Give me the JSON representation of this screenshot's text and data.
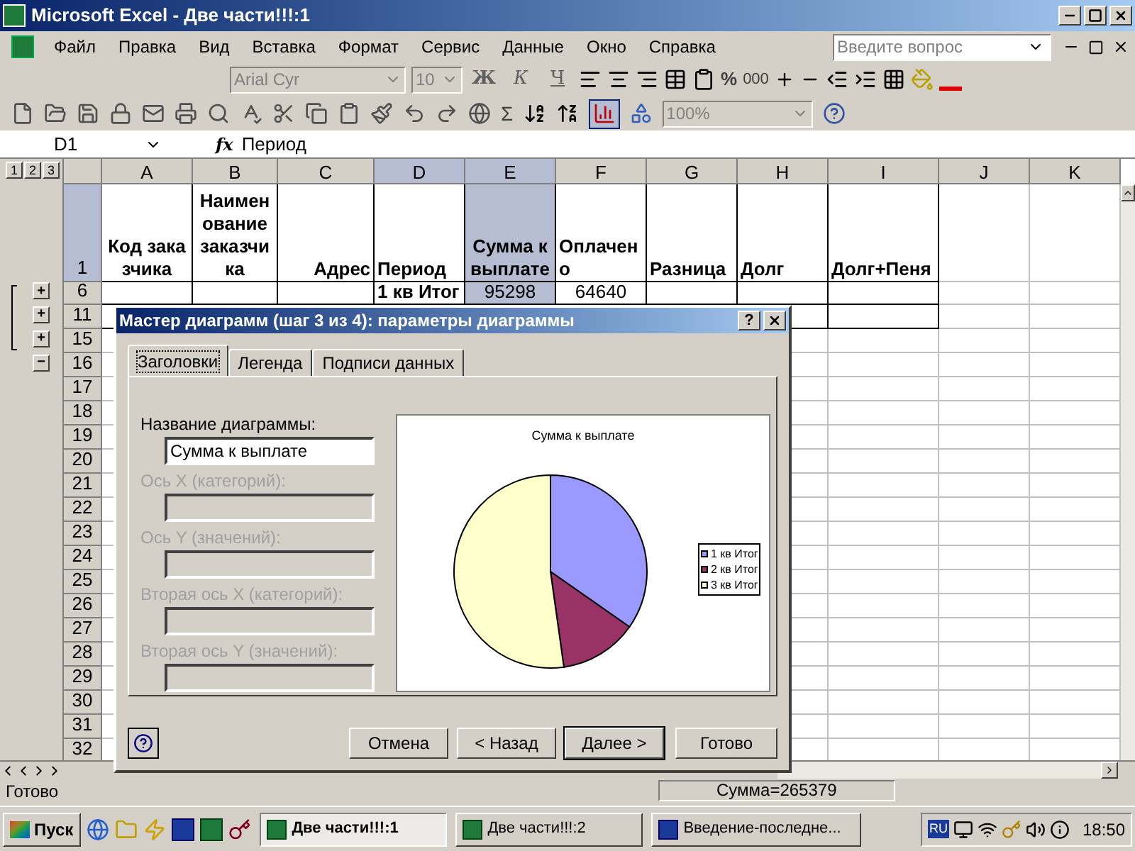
{
  "window": {
    "title": "Microsoft Excel - Две части!!!:1"
  },
  "menu": [
    "Файл",
    "Правка",
    "Вид",
    "Вставка",
    "Формат",
    "Сервис",
    "Данные",
    "Окно",
    "Справка"
  ],
  "help_search": {
    "placeholder": "Введите вопрос"
  },
  "formatting_toolbar": {
    "font": "Arial Cyr",
    "size": "10",
    "style_buttons": [
      "Ж",
      "К",
      "Ч"
    ],
    "percent": "%",
    "thousands": "000"
  },
  "standard_toolbar": {
    "sum": "Σ",
    "zoom": "100%",
    "chart_wizard_pressed": true
  },
  "formula_bar": {
    "cell": "D1",
    "fx": "fx",
    "value": "Период"
  },
  "outline_levels": [
    "1",
    "2",
    "3"
  ],
  "sheet": {
    "columns": [
      {
        "label": "A",
        "selected": false
      },
      {
        "label": "B",
        "selected": false
      },
      {
        "label": "C",
        "selected": false
      },
      {
        "label": "D",
        "selected": true
      },
      {
        "label": "E",
        "selected": true
      },
      {
        "label": "F",
        "selected": false
      },
      {
        "label": "G",
        "selected": false
      },
      {
        "label": "H",
        "selected": false
      },
      {
        "label": "I",
        "selected": false
      },
      {
        "label": "J",
        "selected": false
      },
      {
        "label": "K",
        "selected": false
      }
    ],
    "rows": [
      {
        "label": "1",
        "selected": true,
        "kind": "header",
        "cells": [
          {
            "text": "Код заказчика",
            "kind": "label",
            "selected": false
          },
          {
            "text": "Наименование заказчика",
            "kind": "label",
            "selected": false
          },
          {
            "text": "Адрес",
            "kind": "label",
            "selected": false
          },
          {
            "text": "Период",
            "kind": "label",
            "selected": false
          },
          {
            "text": "Сумма к выплате",
            "kind": "label",
            "selected": true
          },
          {
            "text": "Оплачено",
            "kind": "label",
            "selected": false
          },
          {
            "text": "Разница",
            "kind": "label",
            "selected": false
          },
          {
            "text": "Долг",
            "kind": "label",
            "selected": false
          },
          {
            "text": "Долг+Пеня",
            "kind": "label",
            "selected": false
          }
        ]
      },
      {
        "label": "6",
        "selected": false,
        "kind": "data",
        "outline": "+",
        "cells": [
          null,
          null,
          null,
          {
            "text": "1 кв Итог",
            "kind": "label",
            "selected": false
          },
          {
            "text": "95298",
            "kind": "number",
            "selected": true
          },
          {
            "text": "64640",
            "kind": "number",
            "selected": false
          }
        ]
      },
      {
        "label": "11",
        "selected": false,
        "kind": "data",
        "outline": "+"
      },
      {
        "label": "15",
        "selected": false,
        "kind": "empty",
        "outline": "+"
      },
      {
        "label": "16",
        "selected": false,
        "kind": "empty",
        "outline": "−"
      },
      {
        "label": "17",
        "selected": false,
        "kind": "empty"
      },
      {
        "label": "18",
        "selected": false,
        "kind": "empty"
      },
      {
        "label": "19",
        "selected": false,
        "kind": "empty"
      },
      {
        "label": "20",
        "selected": false,
        "kind": "empty"
      },
      {
        "label": "21",
        "selected": false,
        "kind": "empty"
      },
      {
        "label": "22",
        "selected": false,
        "kind": "empty"
      },
      {
        "label": "23",
        "selected": false,
        "kind": "empty"
      },
      {
        "label": "24",
        "selected": false,
        "kind": "empty"
      },
      {
        "label": "25",
        "selected": false,
        "kind": "empty"
      },
      {
        "label": "26",
        "selected": false,
        "kind": "empty"
      },
      {
        "label": "27",
        "selected": false,
        "kind": "empty"
      },
      {
        "label": "28",
        "selected": false,
        "kind": "empty"
      },
      {
        "label": "29",
        "selected": false,
        "kind": "empty"
      },
      {
        "label": "30",
        "selected": false,
        "kind": "empty"
      },
      {
        "label": "31",
        "selected": false,
        "kind": "empty"
      },
      {
        "label": "32",
        "selected": false,
        "kind": "empty"
      }
    ]
  },
  "dialog": {
    "title": "Мастер диаграмм (шаг 3 из 4): параметры диаграммы",
    "help": "?",
    "tabs": [
      {
        "label": "Заголовки",
        "selected": true
      },
      {
        "label": "Легенда",
        "selected": false
      },
      {
        "label": "Подписи данных",
        "selected": false
      }
    ],
    "fields": [
      {
        "label": "Название диаграммы:",
        "value": "Сумма к выплате",
        "disabled": false
      },
      {
        "label": "Ось X (категорий):",
        "disabled": true
      },
      {
        "label": "Ось Y (значений):",
        "disabled": true
      },
      {
        "label": "Вторая ось X (категорий):",
        "disabled": true
      },
      {
        "label": "Вторая ось Y (значений):",
        "disabled": true
      }
    ],
    "preview": {
      "title": "Сумма к выплате",
      "legend": [
        {
          "label": "1 кв Итог",
          "color": "#9999ff"
        },
        {
          "label": "2 кв Итог",
          "color": "#993366"
        },
        {
          "label": "3 кв Итог",
          "color": "#ffffcc"
        }
      ]
    },
    "buttons": [
      {
        "label": "Отмена",
        "default": false
      },
      {
        "label": "< Назад",
        "default": false
      },
      {
        "label": "Далее >",
        "default": true
      },
      {
        "label": "Готово",
        "default": false
      }
    ]
  },
  "status_bar": {
    "state": "Готово",
    "sum": "Сумма=265379"
  },
  "taskbar": {
    "start": "Пуск",
    "tasks": [
      {
        "label": "Две части!!!:1",
        "selected": true
      },
      {
        "label": "Две части!!!:2",
        "selected": false
      },
      {
        "label": "Введение-последне...",
        "selected": false
      }
    ],
    "language": "RU",
    "clock": "18:50"
  }
}
